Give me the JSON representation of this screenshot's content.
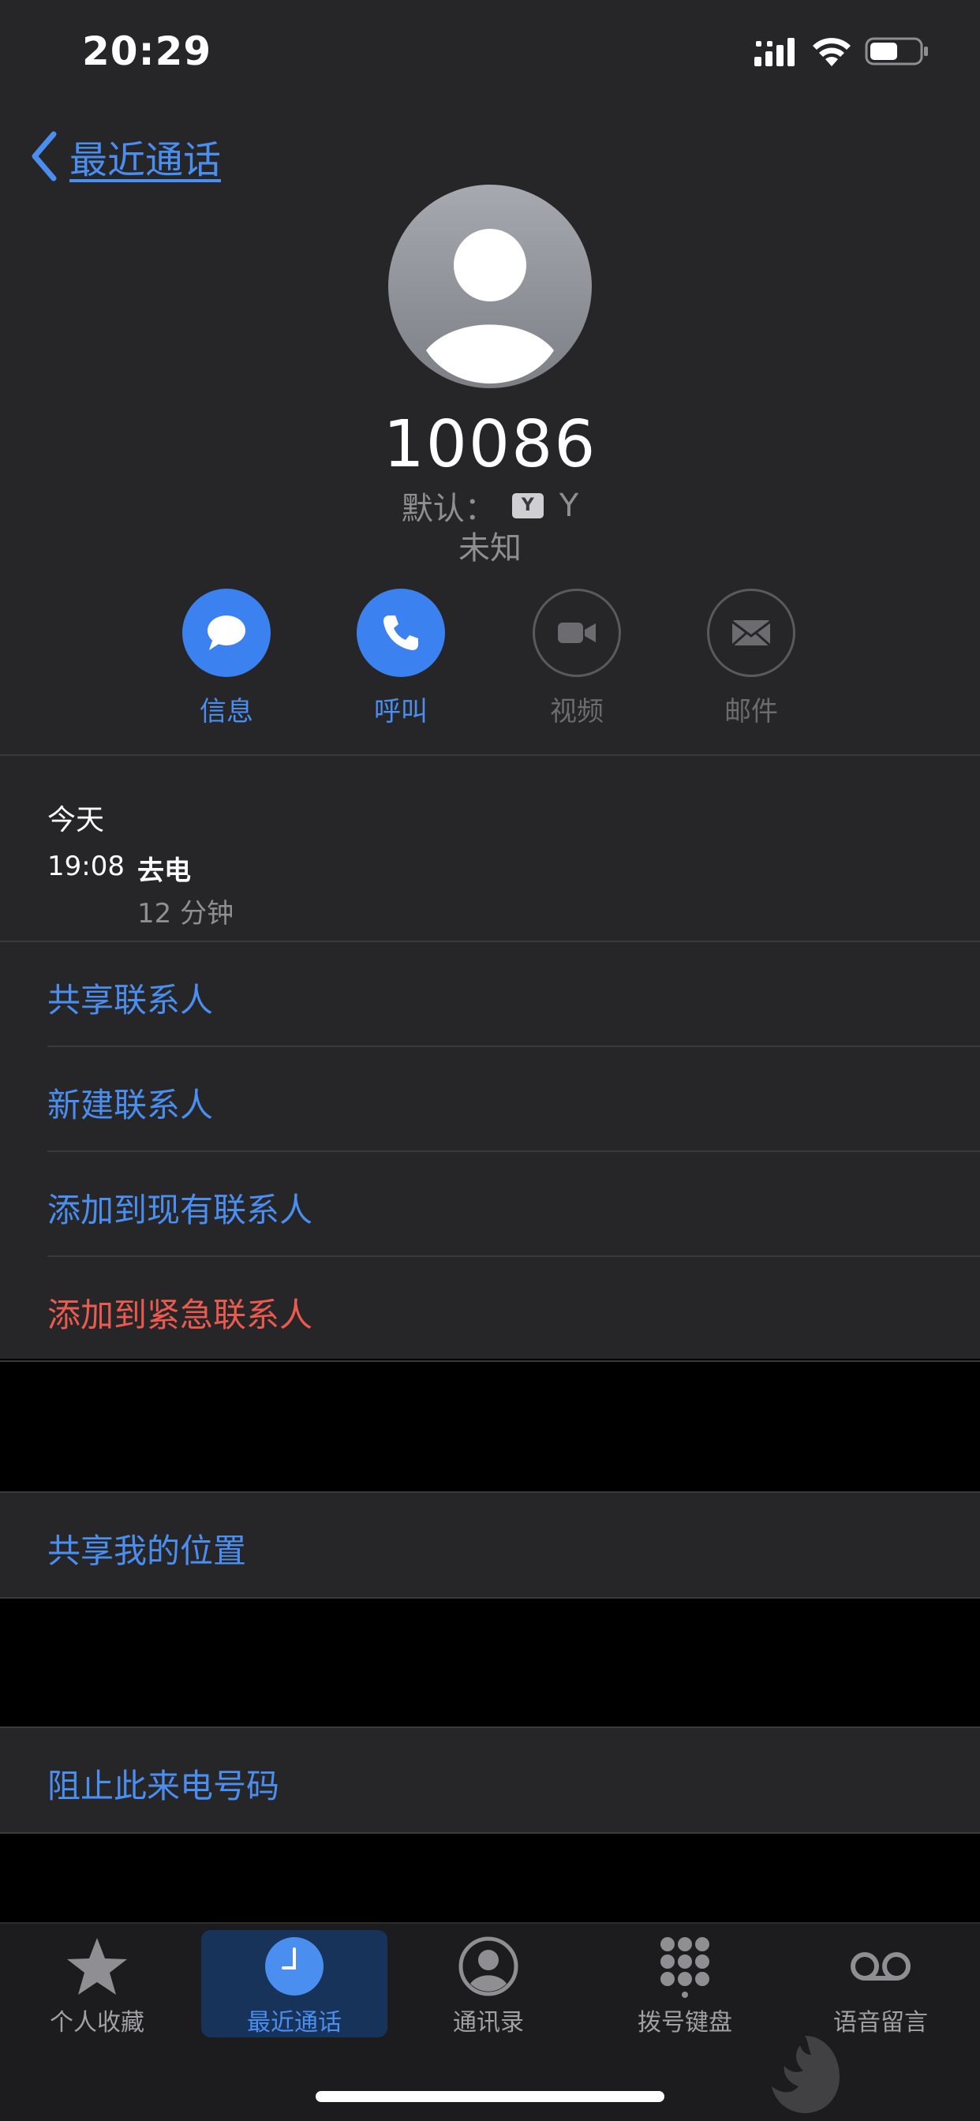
{
  "status_bar": {
    "time": "20:29"
  },
  "nav": {
    "back_label": "最近通话"
  },
  "contact": {
    "number": "10086",
    "default_label": "默认：",
    "sim_badge": "Y",
    "sim_name": "Y",
    "location": "未知"
  },
  "actions": [
    {
      "label": "信息",
      "icon": "message-icon",
      "enabled": true
    },
    {
      "label": "呼叫",
      "icon": "phone-icon",
      "enabled": true
    },
    {
      "label": "视频",
      "icon": "video-icon",
      "enabled": false
    },
    {
      "label": "邮件",
      "icon": "mail-icon",
      "enabled": false
    }
  ],
  "call_history": {
    "day": "今天",
    "time": "19:08",
    "type": "去电",
    "duration": "12 分钟"
  },
  "contact_options": [
    "共享联系人",
    "新建联系人",
    "添加到现有联系人",
    "添加到紧急联系人"
  ],
  "share_location": "共享我的位置",
  "block_number": "阻止此来电号码",
  "tabs": [
    {
      "label": "个人收藏",
      "icon": "star-icon",
      "active": false
    },
    {
      "label": "最近通话",
      "icon": "clock-icon",
      "active": true
    },
    {
      "label": "通讯录",
      "icon": "person-circle-icon",
      "active": false
    },
    {
      "label": "拨号键盘",
      "icon": "keypad-icon",
      "active": false
    },
    {
      "label": "语音留言",
      "icon": "voicemail-icon",
      "active": false
    }
  ],
  "colors": {
    "accent": "#4a8ef0",
    "destructive": "#eb5a4f",
    "surface": "#262628",
    "background": "#000000"
  }
}
